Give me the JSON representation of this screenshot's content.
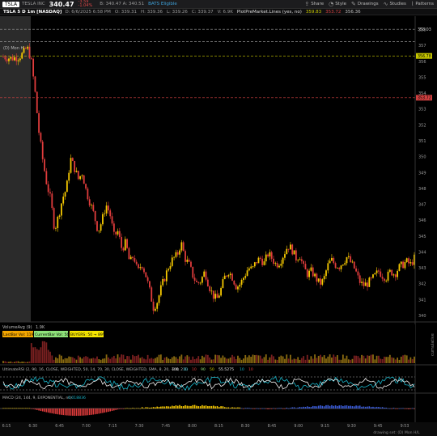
{
  "topbar": {
    "symbol": "TSLA",
    "company": "TESLA INC",
    "last": "340.47",
    "change": "-3.59",
    "change_pct": "-1.04%",
    "bid_ask": "B: 340.47  A: 340.51",
    "note": "BATS Eligible",
    "buttons": [
      {
        "label": "Share",
        "icon": "share-icon"
      },
      {
        "label": "Style",
        "icon": "style-icon"
      },
      {
        "label": "Drawings",
        "icon": "drawings-icon"
      },
      {
        "label": "Studies",
        "icon": "studies-icon"
      },
      {
        "label": "Patterns",
        "icon": "patterns-icon"
      }
    ]
  },
  "titlebar": {
    "chart_id": "TSLA 5 D 1m [NASDAQ]",
    "date": "D: 6/6/2025 6:58 PM",
    "open": "O: 339.31",
    "high": "H: 339.36",
    "low": "L: 339.26",
    "close": "C: 339.37",
    "vol": "V: 6.9K",
    "study": "PlotPreMarket.Lines (yes, no)",
    "pm_high": "359.83",
    "pm_low": "353.72",
    "pm_close": "356.36"
  },
  "overlays": {
    "marker": "(D) Mon H",
    "y_badges": [
      "356.78",
      "353.72"
    ]
  },
  "chart_data": [
    {
      "type": "candlestick",
      "ylim": [
        339.6,
        358.6
      ],
      "y_ticks": [
        340,
        341,
        342,
        343,
        344,
        345,
        346,
        347,
        348,
        349,
        350,
        351,
        352,
        353,
        354,
        355,
        356,
        357,
        358
      ],
      "x_ticks": [
        "6:15",
        "6:30",
        "6:45",
        "7:00",
        "7:15",
        "7:30",
        "7:45",
        "8:00",
        "8:15",
        "8:30",
        "8:45",
        "9:00",
        "9:15",
        "9:30",
        "9:45",
        "9:53"
      ],
      "levels": [
        {
          "value": 358.03,
          "label": "358.03",
          "color": "#9a9a9a"
        },
        {
          "value": 357.25,
          "color": "#9a9a9a"
        },
        {
          "value": 356.35,
          "label": "356.78",
          "color": "#c8c800"
        },
        {
          "value": 353.72,
          "label": "353.72",
          "color": "#d04040"
        }
      ],
      "close_path": [
        [
          0,
          356.3
        ],
        [
          2,
          356.2
        ],
        [
          4,
          356.3
        ],
        [
          5,
          356.5
        ],
        [
          6,
          356.9
        ],
        [
          7,
          356.2
        ],
        [
          8,
          354.2
        ],
        [
          9,
          351.6
        ],
        [
          10,
          349.8
        ],
        [
          11,
          348.3
        ],
        [
          12,
          347.3
        ],
        [
          13,
          345.4
        ],
        [
          14,
          346.3
        ],
        [
          15,
          347.4
        ],
        [
          16,
          348.0
        ],
        [
          17,
          349.9
        ],
        [
          18,
          349.3
        ],
        [
          19,
          348.6
        ],
        [
          20,
          349.0
        ],
        [
          21,
          347.8
        ],
        [
          22,
          347.1
        ],
        [
          23,
          346.3
        ],
        [
          24,
          345.3
        ],
        [
          25,
          346.0
        ],
        [
          26,
          347.0
        ],
        [
          27,
          346.4
        ],
        [
          28,
          345.0
        ],
        [
          29,
          345.3
        ],
        [
          30,
          344.2
        ],
        [
          31,
          344.6
        ],
        [
          32,
          343.3
        ],
        [
          33,
          343.8
        ],
        [
          34,
          342.7
        ],
        [
          35,
          343.3
        ],
        [
          36,
          342.6
        ],
        [
          37,
          341.6
        ],
        [
          38,
          340.5
        ],
        [
          39,
          340.9
        ],
        [
          40,
          341.8
        ],
        [
          41,
          342.5
        ],
        [
          42,
          343.2
        ],
        [
          43,
          343.6
        ],
        [
          44,
          343.8
        ],
        [
          45,
          344.6
        ],
        [
          46,
          343.6
        ],
        [
          47,
          343.2
        ],
        [
          48,
          342.5
        ],
        [
          49,
          342.0
        ],
        [
          50,
          342.2
        ],
        [
          51,
          342.8
        ],
        [
          52,
          341.9
        ],
        [
          53,
          341.3
        ],
        [
          54,
          341.0
        ],
        [
          55,
          341.6
        ],
        [
          56,
          342.4
        ],
        [
          57,
          342.8
        ],
        [
          58,
          342.4
        ],
        [
          59,
          341.8
        ],
        [
          60,
          342.0
        ],
        [
          61,
          342.5
        ],
        [
          62,
          343.0
        ],
        [
          63,
          342.9
        ],
        [
          64,
          343.4
        ],
        [
          65,
          343.6
        ],
        [
          66,
          343.3
        ],
        [
          67,
          343.9
        ],
        [
          68,
          343.6
        ],
        [
          69,
          343.2
        ],
        [
          70,
          343.4
        ],
        [
          71,
          343.9
        ],
        [
          72,
          344.4
        ],
        [
          73,
          344.2
        ],
        [
          74,
          343.6
        ],
        [
          75,
          343.8
        ],
        [
          76,
          343.0
        ],
        [
          77,
          342.6
        ],
        [
          78,
          342.8
        ],
        [
          79,
          342.4
        ],
        [
          80,
          342.0
        ],
        [
          81,
          342.2
        ],
        [
          82,
          343.1
        ],
        [
          83,
          343.5
        ],
        [
          84,
          343.2
        ],
        [
          85,
          343.1
        ],
        [
          86,
          343.4
        ],
        [
          87,
          343.7
        ],
        [
          88,
          343.3
        ],
        [
          89,
          342.9
        ],
        [
          90,
          342.2
        ],
        [
          91,
          341.9
        ],
        [
          92,
          342.0
        ],
        [
          93,
          342.2
        ],
        [
          94,
          342.5
        ],
        [
          95,
          342.8
        ],
        [
          96,
          342.5
        ],
        [
          97,
          342.4
        ],
        [
          98,
          342.8
        ],
        [
          99,
          342.6
        ],
        [
          100,
          343.0
        ],
        [
          101,
          343.2
        ],
        [
          102,
          343.4
        ],
        [
          103,
          343.2
        ],
        [
          104,
          343.6
        ]
      ]
    },
    {
      "type": "bar",
      "name": "VolumeAvg (9)",
      "value_label": "1.9K",
      "tags": [
        "LastBar Vol: 119",
        "CurrentBar Vol: 56",
        "BUYERS: 50 → 89%"
      ]
    },
    {
      "type": "line",
      "name": "UltimateRSI (2, 90, 16, CLOSE, WEIGHTED, 50, 14, 70, 30, CLOSE, WEIGHTED, SMA, 8, 20, -2.0, 2.0)",
      "values": [
        "100",
        "10",
        "10",
        "90",
        "50",
        "55.5275",
        "10",
        "10"
      ]
    },
    {
      "type": "bar",
      "name": "MACD (24, 144, 9, EXPONENTIAL, no)",
      "value": "0.018836"
    }
  ],
  "scroll_badge": "drawing set: (D) Mon H/L",
  "colors": {
    "up": "#f5c800",
    "down": "#e03c3c",
    "premarket_bg": "#2b2b2b",
    "accent": "#19b4c8"
  }
}
